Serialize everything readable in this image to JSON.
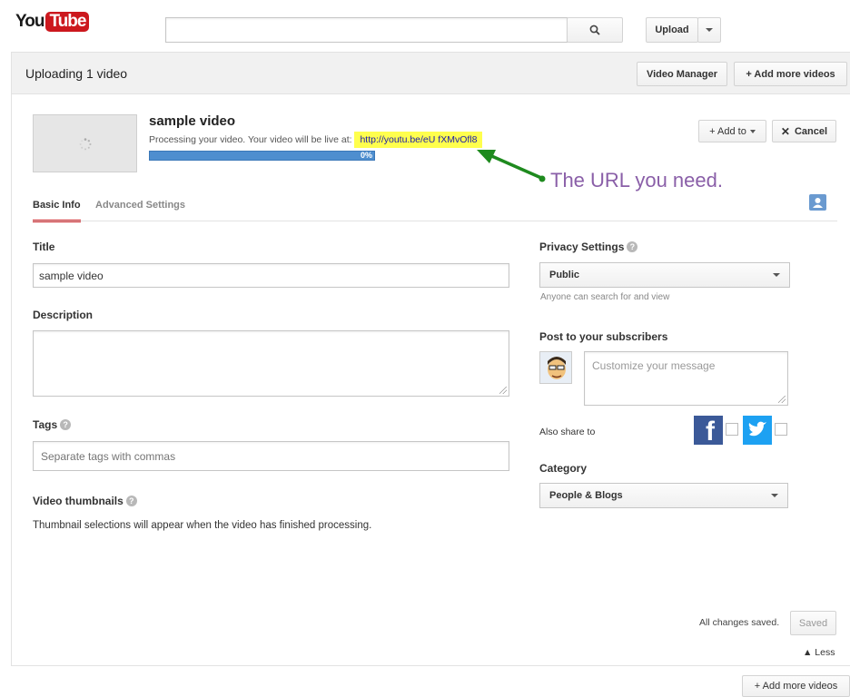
{
  "header": {
    "logo_you": "You",
    "logo_tube": "Tube",
    "search_placeholder": "",
    "search_icon": "magnifier-icon",
    "upload_label": "Upload"
  },
  "subheader": {
    "title": "Uploading 1 video",
    "video_manager_label": "Video Manager",
    "add_more_label": "+ Add more videos"
  },
  "video": {
    "title": "sample video",
    "processing_text": "Processing your video. Your video will be live at:",
    "url": "http://youtu.be/eU fXMvOfl8",
    "progress_label": "0%",
    "progress_fraction": 0.0,
    "add_to_label": "+ Add to",
    "cancel_label": "Cancel"
  },
  "annotation": {
    "text": "The URL you need.",
    "color": "#8a5fa8",
    "arrow_color": "#1e8a1e"
  },
  "tabs": [
    {
      "label": "Basic Info",
      "active": true
    },
    {
      "label": "Advanced Settings",
      "active": false
    }
  ],
  "form": {
    "title_label": "Title",
    "title_value": "sample video",
    "description_label": "Description",
    "description_value": "",
    "tags_label": "Tags",
    "tags_placeholder": "Separate tags with commas",
    "thumbnails_label": "Video thumbnails",
    "thumbnails_note": "Thumbnail selections will appear when the video has finished processing."
  },
  "privacy": {
    "label": "Privacy Settings",
    "selected": "Public",
    "hint": "Anyone can search for and view"
  },
  "subscribers": {
    "label": "Post to your subscribers",
    "message_placeholder": "Customize your message",
    "also_share_label": "Also share to"
  },
  "category": {
    "label": "Category",
    "selected": "People & Blogs"
  },
  "footer": {
    "saved_status": "All changes saved.",
    "saved_button": "Saved",
    "less_label": "▲ Less",
    "add_more_label": "+ Add more videos"
  },
  "colors": {
    "youtube_red": "#cc181e",
    "progress_blue": "#4e8ecf",
    "highlight": "#ffff4d",
    "facebook": "#3b5998",
    "twitter": "#1da1f2"
  }
}
